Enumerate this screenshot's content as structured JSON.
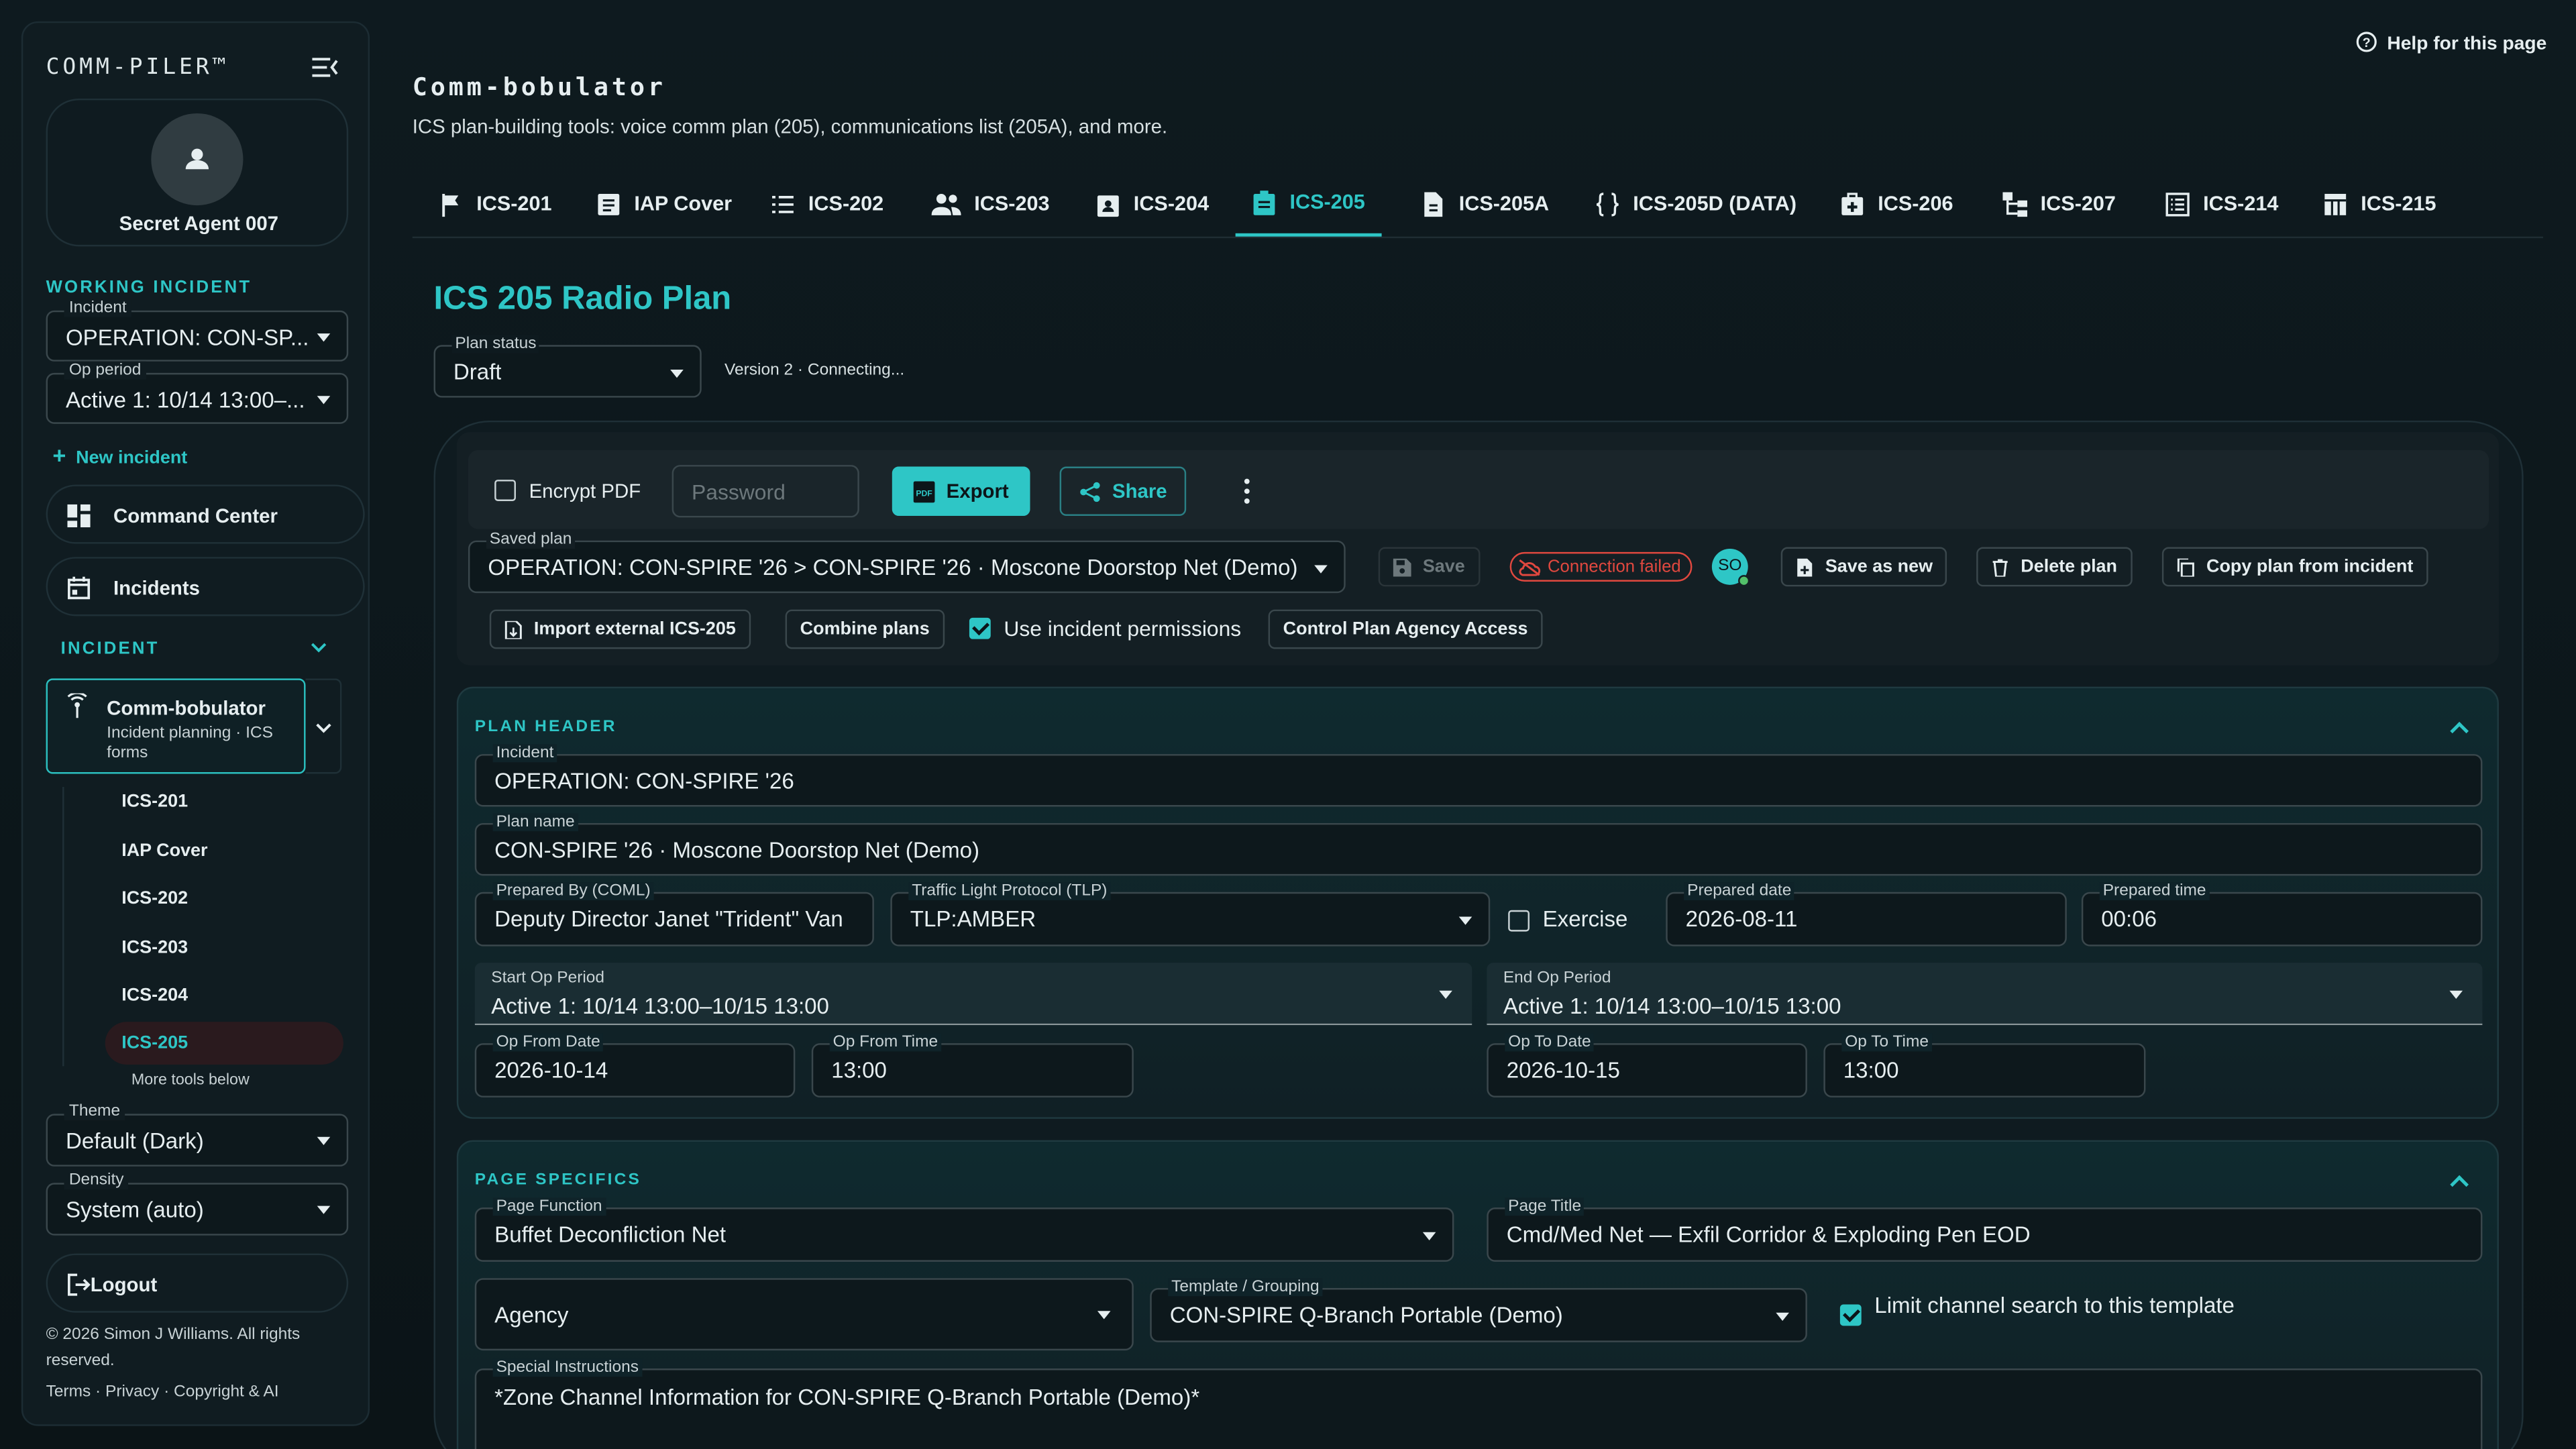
{
  "brand": "COMM-PILER™",
  "user": {
    "name": "Secret Agent 007"
  },
  "sidebar": {
    "working_label": "WORKING INCIDENT",
    "incident_label": "Incident",
    "incident_value": "OPERATION: CON-SP...",
    "op_label": "Op period",
    "op_value": "Active 1: 10/14 13:00–...",
    "new_incident": "New incident",
    "command_center": "Command Center",
    "incidents": "Incidents",
    "incident_section": "INCIDENT",
    "tool_title": "Comm-bobulator",
    "tool_sub1": "Incident planning · ICS",
    "tool_sub2": "forms",
    "sub_items": [
      "ICS-201",
      "IAP Cover",
      "ICS-202",
      "ICS-203",
      "ICS-204",
      "ICS-205"
    ],
    "more_tools": "More tools below",
    "theme_label": "Theme",
    "theme_value": "Default (Dark)",
    "density_label": "Density",
    "density_value": "System (auto)",
    "logout": "Logout",
    "copyright1": "© 2026 Simon J Williams. All rights",
    "copyright2": "reserved.",
    "footer_links": "Terms · Privacy · Copyright & AI"
  },
  "header": {
    "title": "Comm-bobulator",
    "subtitle": "ICS plan-building tools: voice comm plan (205), communications list (205A), and more.",
    "help": "Help for this page"
  },
  "tabs": [
    "ICS-201",
    "IAP Cover",
    "ICS-202",
    "ICS-203",
    "ICS-204",
    "ICS-205",
    "ICS-205A",
    "ICS-205D (DATA)",
    "ICS-206",
    "ICS-207",
    "ICS-214",
    "ICS-215"
  ],
  "active_tab": "ICS-205",
  "page": {
    "heading": "ICS 205 Radio Plan",
    "status_label": "Plan status",
    "status_value": "Draft",
    "version": "Version 2 · Connecting..."
  },
  "toolbar": {
    "encrypt_pdf": "Encrypt PDF",
    "password_placeholder": "Password",
    "export": "Export",
    "share": "Share",
    "saved_plan_label": "Saved plan",
    "saved_plan_value": "OPERATION: CON-SPIRE '26 > CON-SPIRE '26 · Moscone Doorstop Net (Demo)",
    "save": "Save",
    "connection": "Connection failed",
    "avatar": "SO",
    "save_as_new": "Save as new",
    "delete_plan": "Delete plan",
    "copy_plan": "Copy plan from incident",
    "import": "Import external ICS-205",
    "combine": "Combine plans",
    "use_perms": "Use incident permissions",
    "control_access": "Control Plan Agency Access"
  },
  "plan_header": {
    "title": "PLAN HEADER",
    "incident_label": "Incident",
    "incident_value": "OPERATION: CON-SPIRE '26",
    "plan_name_label": "Plan name",
    "plan_name_value": "CON-SPIRE '26 · Moscone Doorstop Net (Demo)",
    "prepared_by_label": "Prepared By (COML)",
    "prepared_by_value": "Deputy Director Janet \"Trident\" Van",
    "tlp_label": "Traffic Light Protocol (TLP)",
    "tlp_value": "TLP:AMBER",
    "exercise": "Exercise",
    "prep_date_label": "Prepared date",
    "prep_date_value": "2026-08-11",
    "prep_time_label": "Prepared time",
    "prep_time_value": "00:06",
    "start_op_label": "Start Op Period",
    "start_op_value": "Active 1: 10/14 13:00–10/15 13:00",
    "end_op_label": "End Op Period",
    "end_op_value": "Active 1: 10/14 13:00–10/15 13:00",
    "op_from_date_label": "Op From Date",
    "op_from_date_value": "2026-10-14",
    "op_from_time_label": "Op From Time",
    "op_from_time_value": "13:00",
    "op_to_date_label": "Op To Date",
    "op_to_date_value": "2026-10-15",
    "op_to_time_label": "Op To Time",
    "op_to_time_value": "13:00"
  },
  "page_specifics": {
    "title": "PAGE SPECIFICS",
    "function_label": "Page Function",
    "function_value": "Buffet Deconfliction Net",
    "page_title_label": "Page Title",
    "page_title_value": "Cmd/Med Net — Exfil Corridor & Exploding Pen EOD",
    "agency_placeholder": "Agency",
    "template_label": "Template / Grouping",
    "template_value": "CON-SPIRE Q-Branch Portable (Demo)",
    "limit_label": "Limit channel search to this template",
    "special_label": "Special Instructions",
    "special_value": "*Zone Channel Information for CON-SPIRE Q-Branch Portable (Demo)*"
  },
  "colors": {
    "accent": "#2ec6c6",
    "error": "#e0483f",
    "background": "#0c1519"
  }
}
